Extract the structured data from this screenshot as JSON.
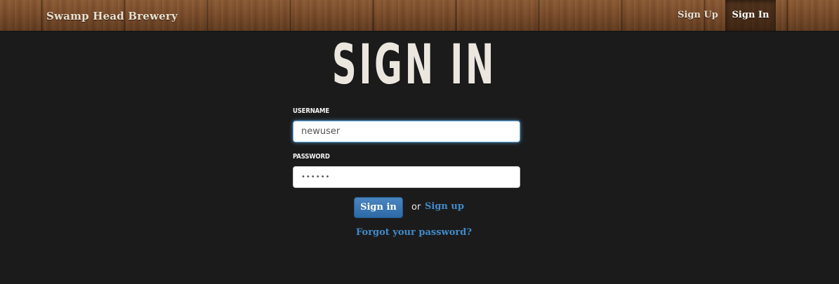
{
  "navbar": {
    "brand": "Swamp Head Brewery",
    "links": [
      {
        "label": "Sign Up",
        "active": false
      },
      {
        "label": "Sign In",
        "active": true
      }
    ]
  },
  "page": {
    "title": "SIGN IN"
  },
  "form": {
    "username_label": "USERNAME",
    "username_value": "newuser",
    "password_label": "PASSWORD",
    "password_value": "••••••",
    "submit_label": "Sign in",
    "or_text": "or",
    "signup_link": "Sign up",
    "forgot_link": "Forgot your password?"
  },
  "colors": {
    "background": "#1b1b1b",
    "accent": "#428bca",
    "button": "#2d6aa6"
  }
}
